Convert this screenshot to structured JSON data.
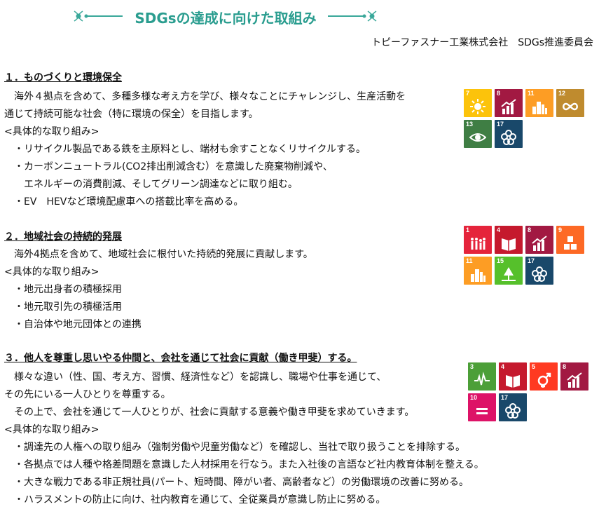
{
  "header": {
    "title": "SDGsの達成に向けた取組み",
    "organization": "トピーファスナー工業株式会社　SDGs推進委員会"
  },
  "sections": [
    {
      "heading": "１．ものづくりと環境保全",
      "body": [
        "　海外４拠点を含めて、多種多様な考え方を学び、様々なことにチャレンジし、生産活動を",
        "通じて持続可能な社会（特に環境の保全）を目指します。"
      ],
      "subheading": "<具体的な取り組み>",
      "items": [
        "・リサイクル製品である鉄を主原料とし、端材も余すことなくリサイクルする。",
        "・カーボンニュートラル(CO2排出削減含む）を意識した廃棄物削減や、",
        "　エネルギーの消費削減、そしてグリーン調達などに取り組む。",
        "・EV　HEVなど環境配慮車への搭載比率を高める。"
      ],
      "sdg_icons": [
        {
          "num": "7",
          "color": "#fcc30b",
          "icon": "sun-icon"
        },
        {
          "num": "8",
          "color": "#a21942",
          "icon": "growth-chart-icon"
        },
        {
          "num": "11",
          "color": "#fd9d24",
          "icon": "city-icon"
        },
        {
          "num": "12",
          "color": "#bf8b2e",
          "icon": "infinity-icon"
        },
        {
          "num": "13",
          "color": "#3f7e44",
          "icon": "eye-globe-icon"
        },
        {
          "num": "17",
          "color": "#19486a",
          "icon": "flower-icon"
        }
      ]
    },
    {
      "heading": "２．地域社会の持続的発展",
      "body": [
        "　海外4拠点を含めて、地域社会に根付いた持続的発展に貢献します。"
      ],
      "subheading": "<具体的な取り組み>",
      "items": [
        "・地元出身者の積極採用",
        "・地元取引先の積極活用",
        "・自治体や地元団体との連携"
      ],
      "sdg_icons": [
        {
          "num": "1",
          "color": "#e5243b",
          "icon": "people-icon"
        },
        {
          "num": "4",
          "color": "#c5192d",
          "icon": "book-icon"
        },
        {
          "num": "8",
          "color": "#a21942",
          "icon": "growth-chart-icon"
        },
        {
          "num": "9",
          "color": "#fd6925",
          "icon": "cubes-icon"
        },
        {
          "num": "11",
          "color": "#fd9d24",
          "icon": "city-icon"
        },
        {
          "num": "15",
          "color": "#56c02b",
          "icon": "tree-icon"
        },
        {
          "num": "17",
          "color": "#19486a",
          "icon": "flower-icon"
        }
      ]
    },
    {
      "heading": "３．他人を尊重し思いやる仲間と、会社を通じて社会に貢献（働き甲斐）する。",
      "body": [
        "　様々な違い（性、国、考え方、習慣、経済性など）を認識し、職場や仕事を通じて、",
        "その先にいる一人ひとりを尊重する。",
        "　その上で、会社を通じて一人ひとりが、社会に貢献する意義や働き甲斐を求めていきます。"
      ],
      "subheading": "<具体的な取り組み>",
      "items": [
        "・調達先の人権への取り組み（強制労働や児童労働など）を確認し、当社で取り扱うことを排除する。",
        "・各拠点では人種や格差問題を意識した人材採用を行なう。また入社後の言語など社内教育体制を整える。",
        "・大きな戦力である非正規社員(パート、短時間、障がい者、高齢者など）の労働環境の改善に努める。",
        "・ハラスメントの防止に向け、社内教育を通じて、全従業員が意識し防止に努める。"
      ],
      "sdg_icons": [
        {
          "num": "3",
          "color": "#4c9f38",
          "icon": "heartbeat-icon"
        },
        {
          "num": "4",
          "color": "#c5192d",
          "icon": "book-icon"
        },
        {
          "num": "5",
          "color": "#ff3a21",
          "icon": "gender-icon"
        },
        {
          "num": "8",
          "color": "#a21942",
          "icon": "growth-chart-icon"
        },
        {
          "num": "10",
          "color": "#dd1367",
          "icon": "equality-icon"
        },
        {
          "num": "17",
          "color": "#19486a",
          "icon": "flower-icon"
        }
      ]
    }
  ],
  "colors": {
    "title_teal": "#2a9d8f",
    "ornament_teal": "#3aa89a"
  }
}
